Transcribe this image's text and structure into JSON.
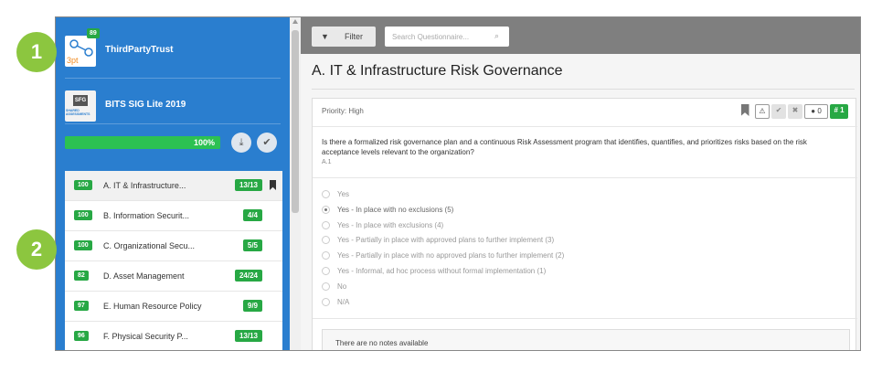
{
  "markers": {
    "one": "1",
    "two": "2"
  },
  "sidebar": {
    "org_primary": {
      "name": "ThirdPartyTrust",
      "score": "89",
      "logo_text": "3pt"
    },
    "org_secondary": {
      "name": "BITS SIG Lite 2019",
      "logo_text": "SFG",
      "logo_sub": "SHARED ASSESSMENTS"
    },
    "progress": {
      "label": "100%",
      "fraction": 1.0
    },
    "download_icon": "download-icon",
    "complete_icon": "check-icon",
    "sections": [
      {
        "score": "100",
        "title": "A. IT & Infrastructure...",
        "count": "13/13",
        "active": true,
        "bookmarked": true
      },
      {
        "score": "100",
        "title": "B. Information Securit...",
        "count": "4/4",
        "active": false,
        "bookmarked": false
      },
      {
        "score": "100",
        "title": "C. Organizational Secu...",
        "count": "5/5",
        "active": false,
        "bookmarked": false
      },
      {
        "score": "82",
        "title": "D. Asset Management",
        "count": "24/24",
        "active": false,
        "bookmarked": false
      },
      {
        "score": "97",
        "title": "E. Human Resource Policy",
        "count": "9/9",
        "active": false,
        "bookmarked": false
      },
      {
        "score": "96",
        "title": "F. Physical Security P...",
        "count": "13/13",
        "active": false,
        "bookmarked": false
      }
    ]
  },
  "toolbar": {
    "filter_label": "Filter",
    "search_placeholder": "Search Questionnaire..."
  },
  "main": {
    "title": "A. IT & Infrastructure Risk Governance",
    "question": {
      "priority": "Priority: High",
      "text": "Is there a formalized risk governance plan and a continuous Risk Assessment program that identifies, quantifies, and prioritizes risks based on the risk acceptance levels relevant to the organization?",
      "id": "A.1",
      "comment_count": "0",
      "number_badge": "# 1",
      "options": [
        {
          "label": "Yes",
          "selected": false
        },
        {
          "label": "Yes - In place with no exclusions (5)",
          "selected": true
        },
        {
          "label": "Yes - In place with exclusions (4)",
          "selected": false
        },
        {
          "label": "Yes - Partially in place with approved plans to further implement (3)",
          "selected": false
        },
        {
          "label": "Yes - Partially in place with no approved plans to further implement (2)",
          "selected": false
        },
        {
          "label": "Yes - Informal, ad hoc process without formal implementation (1)",
          "selected": false
        },
        {
          "label": "No",
          "selected": false
        },
        {
          "label": "N/A",
          "selected": false
        }
      ],
      "notes_text": "There are no notes available"
    }
  },
  "colors": {
    "sidebar": "#2a7ecf",
    "accent_green": "#27a844",
    "marker_green": "#8cc63f",
    "toolbar": "#7f7f7f"
  }
}
